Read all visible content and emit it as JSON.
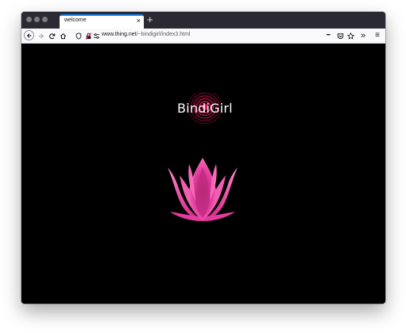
{
  "browser": {
    "tab": {
      "title": "welcome",
      "close_glyph": "×"
    },
    "new_tab_glyph": "+",
    "url": {
      "host": "www.thing.net",
      "path": "/~bindigirl/index3.html"
    },
    "toolbar_glyphs": {
      "more": "•••",
      "overflow": "»",
      "menu": "≡"
    }
  },
  "page": {
    "logo_text": "BindiGirl",
    "colors": {
      "background": "#000000",
      "accent": "#e0135a",
      "lotus": "#f04aa8"
    }
  }
}
